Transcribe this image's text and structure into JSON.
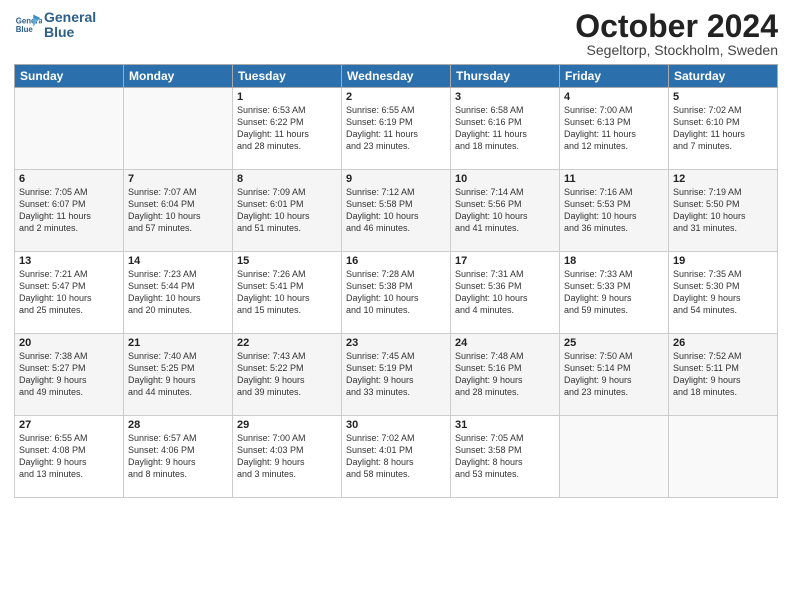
{
  "logo": {
    "line1": "General",
    "line2": "Blue"
  },
  "title": "October 2024",
  "subtitle": "Segeltorp, Stockholm, Sweden",
  "days_of_week": [
    "Sunday",
    "Monday",
    "Tuesday",
    "Wednesday",
    "Thursday",
    "Friday",
    "Saturday"
  ],
  "weeks": [
    [
      {
        "day": "",
        "info": ""
      },
      {
        "day": "",
        "info": ""
      },
      {
        "day": "1",
        "info": "Sunrise: 6:53 AM\nSunset: 6:22 PM\nDaylight: 11 hours\nand 28 minutes."
      },
      {
        "day": "2",
        "info": "Sunrise: 6:55 AM\nSunset: 6:19 PM\nDaylight: 11 hours\nand 23 minutes."
      },
      {
        "day": "3",
        "info": "Sunrise: 6:58 AM\nSunset: 6:16 PM\nDaylight: 11 hours\nand 18 minutes."
      },
      {
        "day": "4",
        "info": "Sunrise: 7:00 AM\nSunset: 6:13 PM\nDaylight: 11 hours\nand 12 minutes."
      },
      {
        "day": "5",
        "info": "Sunrise: 7:02 AM\nSunset: 6:10 PM\nDaylight: 11 hours\nand 7 minutes."
      }
    ],
    [
      {
        "day": "6",
        "info": "Sunrise: 7:05 AM\nSunset: 6:07 PM\nDaylight: 11 hours\nand 2 minutes."
      },
      {
        "day": "7",
        "info": "Sunrise: 7:07 AM\nSunset: 6:04 PM\nDaylight: 10 hours\nand 57 minutes."
      },
      {
        "day": "8",
        "info": "Sunrise: 7:09 AM\nSunset: 6:01 PM\nDaylight: 10 hours\nand 51 minutes."
      },
      {
        "day": "9",
        "info": "Sunrise: 7:12 AM\nSunset: 5:58 PM\nDaylight: 10 hours\nand 46 minutes."
      },
      {
        "day": "10",
        "info": "Sunrise: 7:14 AM\nSunset: 5:56 PM\nDaylight: 10 hours\nand 41 minutes."
      },
      {
        "day": "11",
        "info": "Sunrise: 7:16 AM\nSunset: 5:53 PM\nDaylight: 10 hours\nand 36 minutes."
      },
      {
        "day": "12",
        "info": "Sunrise: 7:19 AM\nSunset: 5:50 PM\nDaylight: 10 hours\nand 31 minutes."
      }
    ],
    [
      {
        "day": "13",
        "info": "Sunrise: 7:21 AM\nSunset: 5:47 PM\nDaylight: 10 hours\nand 25 minutes."
      },
      {
        "day": "14",
        "info": "Sunrise: 7:23 AM\nSunset: 5:44 PM\nDaylight: 10 hours\nand 20 minutes."
      },
      {
        "day": "15",
        "info": "Sunrise: 7:26 AM\nSunset: 5:41 PM\nDaylight: 10 hours\nand 15 minutes."
      },
      {
        "day": "16",
        "info": "Sunrise: 7:28 AM\nSunset: 5:38 PM\nDaylight: 10 hours\nand 10 minutes."
      },
      {
        "day": "17",
        "info": "Sunrise: 7:31 AM\nSunset: 5:36 PM\nDaylight: 10 hours\nand 4 minutes."
      },
      {
        "day": "18",
        "info": "Sunrise: 7:33 AM\nSunset: 5:33 PM\nDaylight: 9 hours\nand 59 minutes."
      },
      {
        "day": "19",
        "info": "Sunrise: 7:35 AM\nSunset: 5:30 PM\nDaylight: 9 hours\nand 54 minutes."
      }
    ],
    [
      {
        "day": "20",
        "info": "Sunrise: 7:38 AM\nSunset: 5:27 PM\nDaylight: 9 hours\nand 49 minutes."
      },
      {
        "day": "21",
        "info": "Sunrise: 7:40 AM\nSunset: 5:25 PM\nDaylight: 9 hours\nand 44 minutes."
      },
      {
        "day": "22",
        "info": "Sunrise: 7:43 AM\nSunset: 5:22 PM\nDaylight: 9 hours\nand 39 minutes."
      },
      {
        "day": "23",
        "info": "Sunrise: 7:45 AM\nSunset: 5:19 PM\nDaylight: 9 hours\nand 33 minutes."
      },
      {
        "day": "24",
        "info": "Sunrise: 7:48 AM\nSunset: 5:16 PM\nDaylight: 9 hours\nand 28 minutes."
      },
      {
        "day": "25",
        "info": "Sunrise: 7:50 AM\nSunset: 5:14 PM\nDaylight: 9 hours\nand 23 minutes."
      },
      {
        "day": "26",
        "info": "Sunrise: 7:52 AM\nSunset: 5:11 PM\nDaylight: 9 hours\nand 18 minutes."
      }
    ],
    [
      {
        "day": "27",
        "info": "Sunrise: 6:55 AM\nSunset: 4:08 PM\nDaylight: 9 hours\nand 13 minutes."
      },
      {
        "day": "28",
        "info": "Sunrise: 6:57 AM\nSunset: 4:06 PM\nDaylight: 9 hours\nand 8 minutes."
      },
      {
        "day": "29",
        "info": "Sunrise: 7:00 AM\nSunset: 4:03 PM\nDaylight: 9 hours\nand 3 minutes."
      },
      {
        "day": "30",
        "info": "Sunrise: 7:02 AM\nSunset: 4:01 PM\nDaylight: 8 hours\nand 58 minutes."
      },
      {
        "day": "31",
        "info": "Sunrise: 7:05 AM\nSunset: 3:58 PM\nDaylight: 8 hours\nand 53 minutes."
      },
      {
        "day": "",
        "info": ""
      },
      {
        "day": "",
        "info": ""
      }
    ]
  ]
}
